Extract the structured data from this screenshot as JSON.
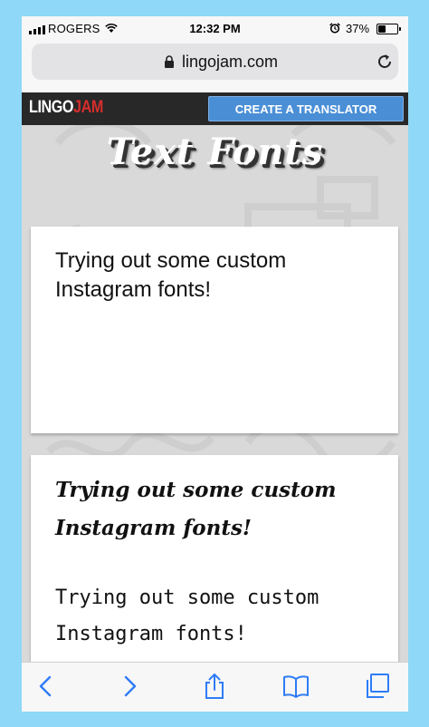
{
  "status_bar": {
    "carrier": "ROGERS",
    "time": "12:32 PM",
    "battery_percent": "37%",
    "battery_level": 0.37,
    "icons": [
      "signal-icon",
      "wifi-icon",
      "alarm-icon",
      "battery-icon"
    ]
  },
  "browser": {
    "url": "lingojam.com",
    "icons": [
      "lock-icon",
      "reload-icon"
    ]
  },
  "site": {
    "logo_part1": "LINGO",
    "logo_part2": "JAM",
    "create_button": "CREATE A TRANSLATOR",
    "page_title": "Text Fonts"
  },
  "translator": {
    "input_text": "Trying out some custom Instagram fonts!",
    "output_bold_italic": "Trying out some custom Instagram fonts!",
    "output_monospace": "Trying out some custom Instagram fonts!"
  },
  "toolbar": {
    "icons": [
      "back-icon",
      "forward-icon",
      "share-icon",
      "bookmarks-icon",
      "tabs-icon"
    ]
  },
  "colors": {
    "frame_background": "#8fd8f7",
    "header_background": "#282828",
    "logo_accent": "#d62d2d",
    "button_blue": "#4a8fd6",
    "ios_blue": "#2f7cf6"
  }
}
